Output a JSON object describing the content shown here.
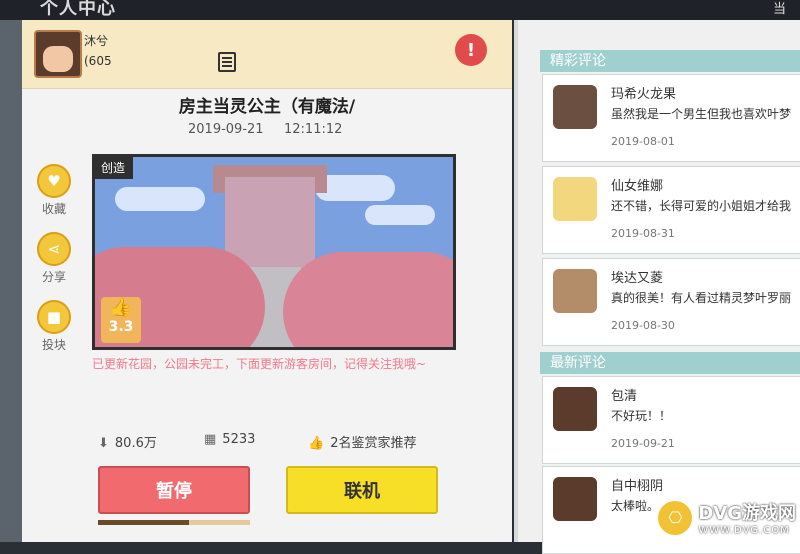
{
  "app": {
    "header_title": "个人中心",
    "header_right": "当"
  },
  "user": {
    "name": "沐兮",
    "id": "(605"
  },
  "map": {
    "title": "房主当灵公主（有魔法/",
    "date": "2019-09-21",
    "time": "12:11:12",
    "badge": "创造",
    "rating": "3.3",
    "description": "已更新花园，公园未完工，下面更新游客房间，记得关注我哦~",
    "downloads": "80.6万",
    "cubes": "5233",
    "recommend": "2名鉴赏家推荐",
    "download_progress": 0.6
  },
  "side_actions": [
    {
      "label": "收藏",
      "icon": "heart-icon"
    },
    {
      "label": "分享",
      "icon": "share-icon"
    },
    {
      "label": "投块",
      "icon": "cube-icon"
    }
  ],
  "buttons": {
    "pause": "暂停",
    "online": "联机"
  },
  "comments": {
    "featured_title": "精彩评论",
    "latest_title": "最新评论",
    "featured": [
      {
        "name": "玛希火龙果",
        "text": "虽然我是一个男生但我也喜欢叶梦",
        "date": "2019-08-01"
      },
      {
        "name": "仙女维娜",
        "text": "还不错，长得可爱的小姐姐才给我",
        "date": "2019-08-31"
      },
      {
        "name": "埃达又菱",
        "text": "真的很美！有人看过精灵梦叶罗丽",
        "date": "2019-08-30"
      }
    ],
    "latest": [
      {
        "name": "包清",
        "text": "不好玩！！",
        "date": "2019-09-21"
      },
      {
        "name": "自中栩阴",
        "text": "太棒啦。",
        "date": ""
      }
    ]
  },
  "watermark": {
    "text": "DVG游戏网",
    "sub": "WWW.DVG.COM"
  }
}
